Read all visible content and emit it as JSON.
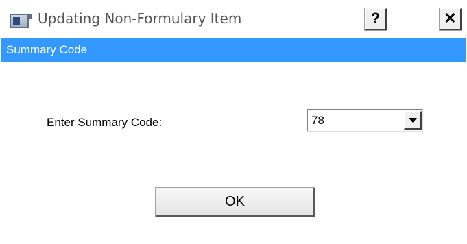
{
  "window": {
    "title": "Updating Non-Formulary Item",
    "help_label": "?",
    "close_label": "✕"
  },
  "header": {
    "title": "Summary Code"
  },
  "form": {
    "label": "Enter Summary Code:",
    "summary_code_value": "78"
  },
  "buttons": {
    "ok_label": "OK"
  },
  "icons": {
    "app": "window-app-icon",
    "dropdown": "chevron-down-icon"
  },
  "colors": {
    "header_band": "#3399ff",
    "header_text": "#ffffff",
    "title_text": "#555555"
  }
}
